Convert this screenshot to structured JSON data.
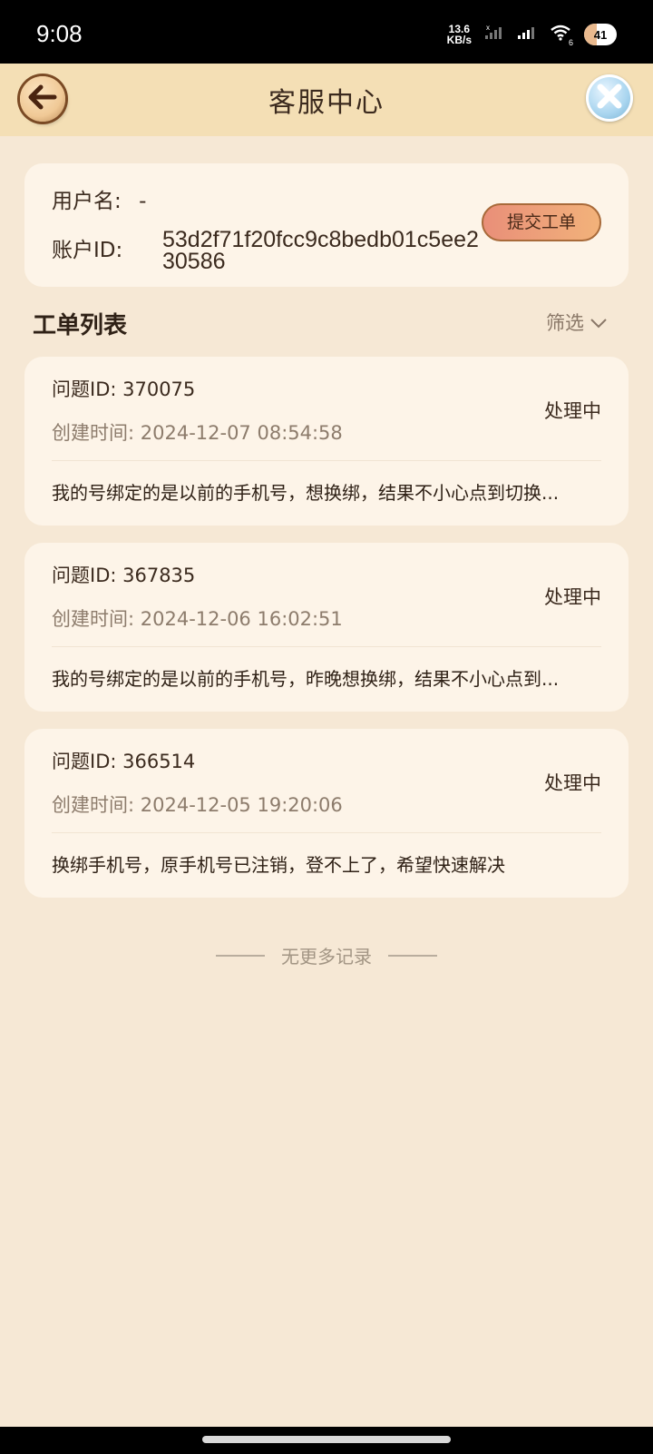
{
  "status_bar": {
    "time": "9:08",
    "net_speed_value": "13.6",
    "net_speed_unit": "KB/s",
    "signal_label": "6",
    "battery": "41"
  },
  "header": {
    "title": "客服中心",
    "back_icon": "back-arrow-icon",
    "close_icon": "close-x-icon"
  },
  "user": {
    "name_label": "用户名:",
    "name_value": "-",
    "account_label": "账户ID:",
    "account_value": "53d2f71f20fcc9c8bedb01c5ee230586",
    "submit_label": "提交工单"
  },
  "list": {
    "title": "工单列表",
    "filter_label": "筛选",
    "tickets": [
      {
        "id": "问题ID: 370075",
        "created": "创建时间: 2024-12-07 08:54:58",
        "status": "处理中",
        "desc": "我的号绑定的是以前的手机号，想换绑，结果不小心点到切换..."
      },
      {
        "id": "问题ID: 367835",
        "created": "创建时间: 2024-12-06 16:02:51",
        "status": "处理中",
        "desc": "我的号绑定的是以前的手机号，昨晚想换绑，结果不小心点到..."
      },
      {
        "id": "问题ID: 366514",
        "created": "创建时间: 2024-12-05 19:20:06",
        "status": "处理中",
        "desc": "换绑手机号，原手机号已注销，登不上了，希望快速解决"
      }
    ],
    "no_more": "无更多记录"
  },
  "colors": {
    "background": "#f6e8d5",
    "header": "#f4dfb5",
    "card": "#fdf4e8",
    "accent_button": "#f2b27a"
  }
}
